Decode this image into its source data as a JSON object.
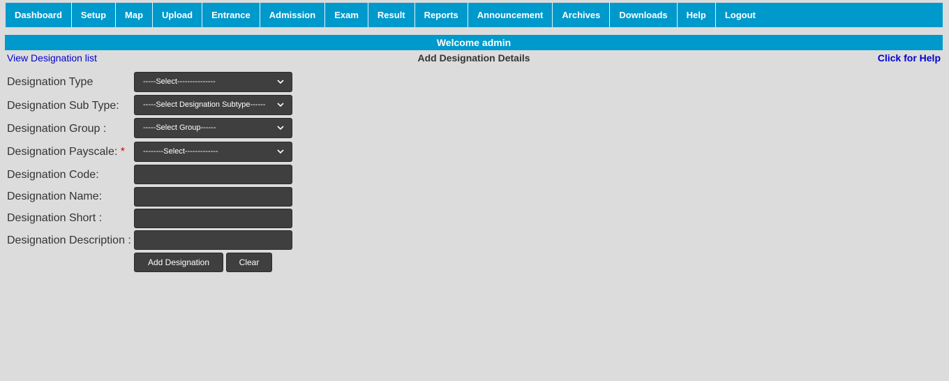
{
  "nav": {
    "items": [
      {
        "label": "Dashboard"
      },
      {
        "label": "Setup"
      },
      {
        "label": "Map"
      },
      {
        "label": "Upload"
      },
      {
        "label": "Entrance"
      },
      {
        "label": "Admission"
      },
      {
        "label": "Exam"
      },
      {
        "label": "Result"
      },
      {
        "label": "Reports"
      },
      {
        "label": "Announcement"
      },
      {
        "label": "Archives"
      },
      {
        "label": "Downloads"
      },
      {
        "label": "Help"
      },
      {
        "label": "Logout"
      }
    ]
  },
  "welcome": "Welcome admin",
  "links": {
    "view_list": "View Designation list",
    "help": "Click for Help"
  },
  "page_title": "Add Designation Details",
  "form": {
    "designation_type": {
      "label": "Designation Type",
      "value": "-----Select---------------"
    },
    "designation_sub_type": {
      "label": "Designation Sub Type:",
      "value": "-----Select Designation Subtype------"
    },
    "designation_group": {
      "label": "Designation Group :",
      "value": "-----Select Group------"
    },
    "designation_payscale": {
      "label": "Designation Payscale:",
      "required_mark": "*",
      "value": "--------Select-------------"
    },
    "designation_code": {
      "label": "Designation Code:",
      "value": ""
    },
    "designation_name": {
      "label": "Designation Name:",
      "value": ""
    },
    "designation_short": {
      "label": "Designation Short :",
      "value": ""
    },
    "designation_description": {
      "label": "Designation Description :",
      "value": ""
    }
  },
  "buttons": {
    "add": "Add Designation",
    "clear": "Clear"
  },
  "colors": {
    "accent": "#0099cc",
    "background": "#dcdcdc",
    "field": "#3f3f3f",
    "link": "#0000cc",
    "required": "#e00000"
  },
  "icons": {
    "select_chevron": "chevron-down-icon"
  }
}
